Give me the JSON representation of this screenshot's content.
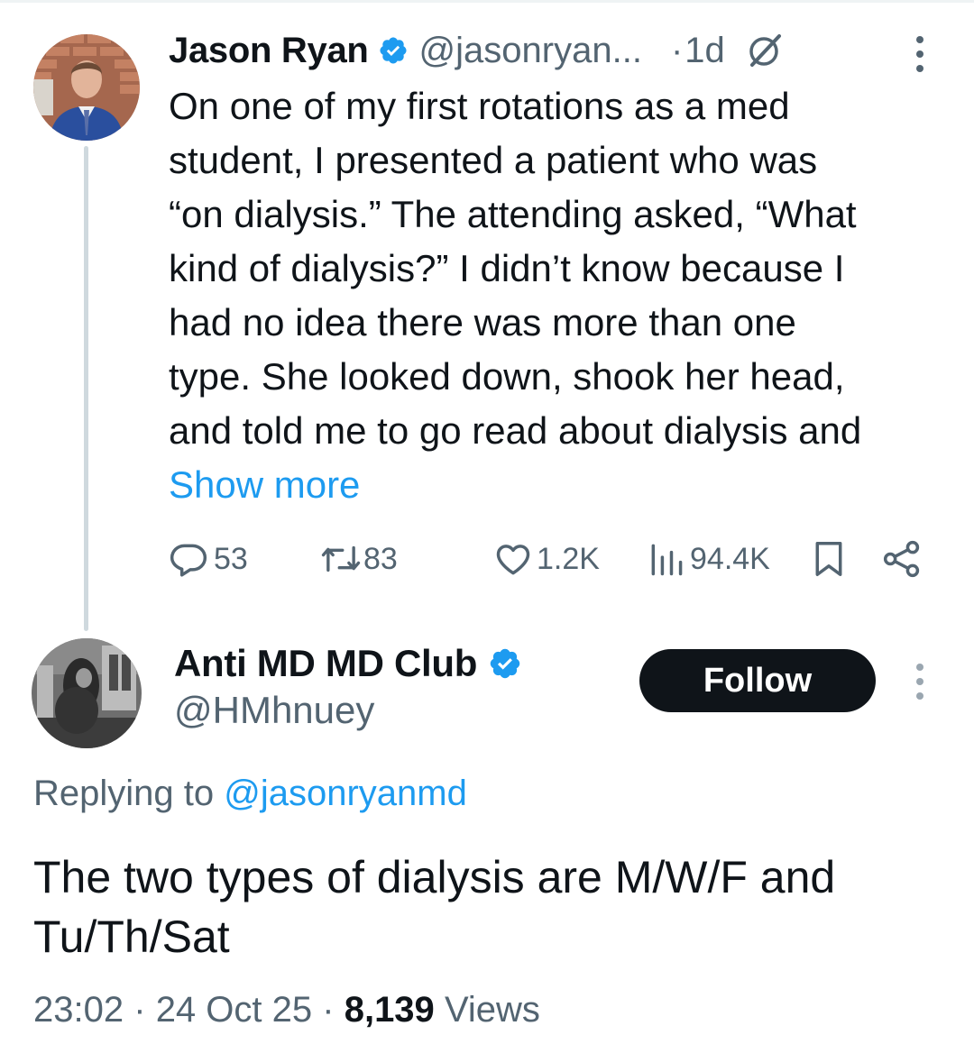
{
  "parent_tweet": {
    "author_name": "Jason Ryan",
    "handle": "@jasonryan...",
    "separator": "·",
    "time_ago": "1d",
    "text": "On one of my first rotations as a med\nstudent, I presented a patient who was\n“on dialysis.” The attending asked, “What\nkind of dialysis?” I didn’t know because I\nhad no idea there was more than one\ntype. She looked down, shook her head,\nand told me to go read about dialysis and",
    "show_more": "Show more",
    "stats": {
      "replies": "53",
      "reposts": "83",
      "likes": "1.2K",
      "views": "94.4K"
    },
    "icons": [
      "verified-badge-icon",
      "grok-icon",
      "more-icon",
      "reply-icon",
      "repost-icon",
      "like-icon",
      "views-icon",
      "bookmark-icon",
      "share-icon"
    ]
  },
  "reply_tweet": {
    "author_name": "Anti MD MD Club",
    "handle": "@HMhnuey",
    "follow_label": "Follow",
    "replying_prefix": "Replying to ",
    "replying_to": "@jasonryanmd",
    "text": "The two types of dialysis are M/W/F and Tu/Th/Sat",
    "time": "23:02",
    "date": "24 Oct 25",
    "view_count": "8,139",
    "views_label": "Views",
    "meta_separator": "·"
  },
  "colors": {
    "text_primary": "#0f1419",
    "text_secondary": "#536471",
    "link_blue": "#1d9bf0",
    "verified_blue": "#1d9bf0",
    "thread_line": "#cfd9de",
    "button_dark": "#0f1419"
  }
}
